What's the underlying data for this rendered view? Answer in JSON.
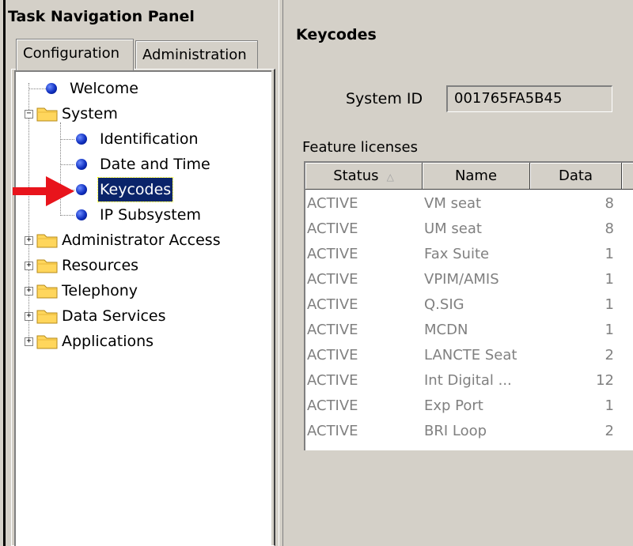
{
  "left_panel": {
    "title": "Task Navigation Panel",
    "tabs": [
      {
        "label": "Configuration",
        "active": true
      },
      {
        "label": "Administration",
        "active": false
      }
    ],
    "tree": {
      "welcome": "Welcome",
      "system": "System",
      "system_children": [
        "Identification",
        "Date and Time",
        "Keycodes",
        "IP Subsystem"
      ],
      "selected": "Keycodes",
      "folders": [
        "Administrator Access",
        "Resources",
        "Telephony",
        "Data Services",
        "Applications"
      ],
      "expanders": {
        "expanded": "−",
        "collapsed": "+"
      }
    }
  },
  "right_panel": {
    "title": "Keycodes",
    "system_id_label": "System ID",
    "system_id_value": "001765FA5B45",
    "licenses_label": "Feature licenses",
    "table": {
      "columns": [
        "Status",
        "Name",
        "Data"
      ],
      "sort_indicator": "△",
      "rows": [
        {
          "status": "ACTIVE",
          "name": "VM seat",
          "data": "8"
        },
        {
          "status": "ACTIVE",
          "name": "UM seat",
          "data": "8"
        },
        {
          "status": "ACTIVE",
          "name": "Fax Suite",
          "data": "1"
        },
        {
          "status": "ACTIVE",
          "name": "VPIM/AMIS",
          "data": "1"
        },
        {
          "status": "ACTIVE",
          "name": "Q.SIG",
          "data": "1"
        },
        {
          "status": "ACTIVE",
          "name": "MCDN",
          "data": "1"
        },
        {
          "status": "ACTIVE",
          "name": "LANCTE Seat",
          "data": "2"
        },
        {
          "status": "ACTIVE",
          "name": "Int Digital ...",
          "data": "12"
        },
        {
          "status": "ACTIVE",
          "name": "Exp Port",
          "data": "1"
        },
        {
          "status": "ACTIVE",
          "name": "BRI Loop",
          "data": "2"
        }
      ]
    }
  },
  "colors": {
    "window_bg": "#d4d0c8",
    "selection_bg": "#0a246a",
    "dim_text": "#808080",
    "annotation_arrow": "#e8141c"
  },
  "icons": [
    "blue-dot-icon",
    "folder-icon",
    "red-arrow-annotation"
  ]
}
